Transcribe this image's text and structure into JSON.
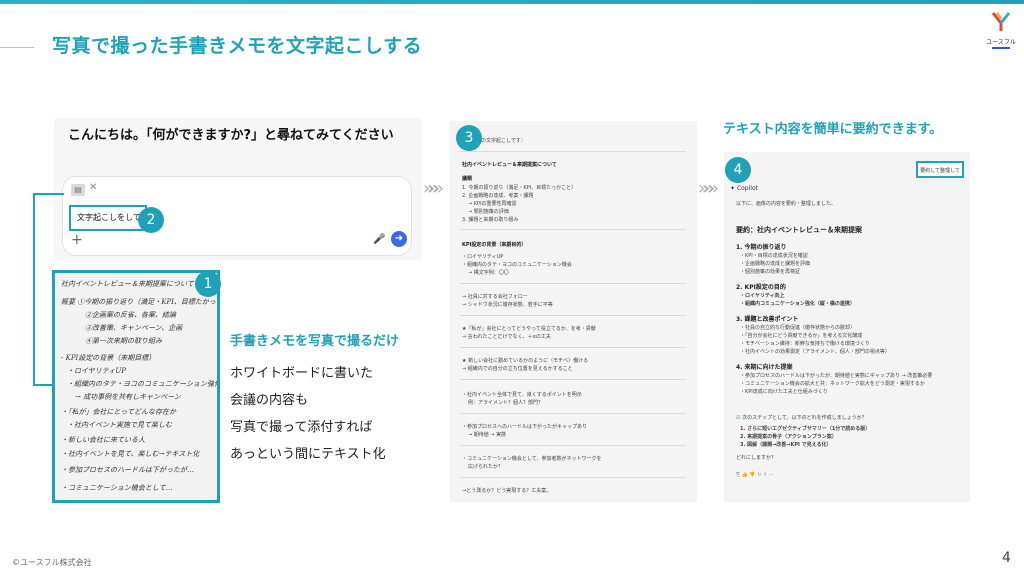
{
  "slide": {
    "title": "写真で撮った手書きメモを文字起こしする",
    "logo_text": "ユースフル",
    "footer": "©ユースフル株式会社",
    "page_number": "4",
    "accent_color": "#1fa2b8"
  },
  "chat": {
    "prompt": "こんにちは。「何ができますか?」と尋ねてみてください",
    "input_value": "文字起こしをして",
    "attachment_close": "✕",
    "plus_icon": "+",
    "mic_icon": "🎤",
    "send_icon": "➜"
  },
  "badges": [
    "1",
    "2",
    "3",
    "4"
  ],
  "memo": {
    "lines": [
      "社内イベントレビュー＆来期提案について",
      "概要  ①今期の振り返り（満足・KPI、目標たかった）",
      "②企画案の反省、各案、結論",
      "③改善策、キャンペーン、企画",
      "④第一次来期の取り組み",
      "- KPI設定の背景（来期目標）",
      "・ロイヤリティUP",
      "・組織内のタテ・ヨコのコミュニケーション強化",
      "→ 成功事例を共有しキャンペーン",
      "・「私が」会社にとってどんな存在か",
      "・社内イベント実施で見て楽しむ",
      "・新しい会社に来ている人",
      "・社内イベントを見て、楽しむ→テキスト化",
      "・参加プロセスのハードルは下がったが…",
      "・コミュニケーション機会として…"
    ]
  },
  "instructions": {
    "subtitle": "手書きメモを写真で撮るだけ",
    "lines": [
      "ホワイトボードに書いた",
      "会議の内容も",
      "写真で撮って添付すれば",
      "あっという間にテキスト化"
    ]
  },
  "arrows": [
    "»»»",
    "»»»"
  ],
  "transcript": {
    "header": "©以下の文字起こしです：",
    "lines": [
      {
        "t": "社内イベントレビュー＆来期提案について",
        "b": true
      },
      {
        "t": "議題",
        "b": true
      },
      {
        "t": "1. 今期の振り返り（満足・KPI、目標たっかこと）",
        "b": false
      },
      {
        "t": "2. 企画戦略の達成、考案・課題",
        "b": false
      },
      {
        "t": "→ KPIの重要性再確認",
        "b": false
      },
      {
        "t": "→ 類別施策の評価",
        "b": false
      },
      {
        "t": "3. 課題と来期の取り組み",
        "b": false
      },
      {
        "t": "KPI設定の背景（来期目的）",
        "b": true
      },
      {
        "t": "・ロイヤリティUP",
        "b": false
      },
      {
        "t": "・組織内のタテ・ヨコのコミュニケーション機会",
        "b": false
      },
      {
        "t": "→ 構文字例：〇〇",
        "b": false
      },
      {
        "t": "→ 社員に対する会社フォロー",
        "b": false
      },
      {
        "t": "→ シャドウ状況に徹存状態、若手に平等",
        "b": false
      },
      {
        "t": "★「私が」会社にとってどうやって役立てるか、を考・貢献",
        "b": false
      },
      {
        "t": "→ 言われたことだけでなく、＋αの工夫",
        "b": false
      },
      {
        "t": "★ 新しい会社に勤めているかのように（モチベ）働ける",
        "b": false
      },
      {
        "t": "→ 組織内での自分の立ち位置を見えるかすること",
        "b": false
      },
      {
        "t": "・社内イベント全体で見て、良くするポイントを明示",
        "b": false
      },
      {
        "t": "例：アライメント？個人？部門？",
        "b": false
      },
      {
        "t": "・参加プロセスへのハードルは下がったがキャップあり",
        "b": false
      },
      {
        "t": "→ 期待値 → 実態",
        "b": false
      },
      {
        "t": "・コミュニケーション機会として、参加者数がネットワークを",
        "b": false
      },
      {
        "t": "広げられたか？",
        "b": false
      },
      {
        "t": "→どう測るか？どう実現する？工夫案。",
        "b": false
      }
    ]
  },
  "summary": {
    "subtitle": "テキスト内容を簡単に要約できます。",
    "button": "要約して整理して",
    "copilot_label": "Copilot",
    "intro": "以下に、画像の内容を要約・整理しました。",
    "title": "要約：社内イベントレビュー＆来期提案",
    "sections": [
      {
        "h": "1. 今期の振り返り",
        "items": [
          "・KPI・目標の達成状況を確認",
          "・企画戦略の達成と課題を評価",
          "・個別施策の効果を再検証"
        ]
      },
      {
        "h": "2. KPI設定の目的",
        "items": [
          "・ロイヤリティ向上",
          "・組織内コミュニケーション強化（縦・横の連携）"
        ]
      },
      {
        "h": "3. 課題と改善ポイント",
        "items": [
          "・社員の自立的な行動促進（徹存状態からの脱却）",
          "・「自分が会社にどう貢献できるか」を考える文化醸成",
          "・モチベーション維持：新鮮な気持ちで働ける環境づくり",
          "・社内イベントの効果測定（アライメント、個人・部門の視点等）"
        ]
      },
      {
        "h": "4. 来期に向けた提案",
        "items": [
          "・参加プロセスのハードルは下がったが、期待値と実態にギャップあり → 改善策必要",
          "・コミュニケーション機会の拡大と共：ネットワーク拡大をどう測定・実現するか",
          "・KPI達成に向けた工夫と仕組みづくり"
        ]
      }
    ],
    "next_title": "次のステップとして、以下のどれを作成しましょうか？",
    "next_items": [
      "1. さらに短いエグゼクティブサマリー（1分で読める版）",
      "2. 来期提案の骨子（アクションプラン案）",
      "3. 図解（課題→改善→KPI で見える化）"
    ],
    "question": "どれにしますか？"
  }
}
